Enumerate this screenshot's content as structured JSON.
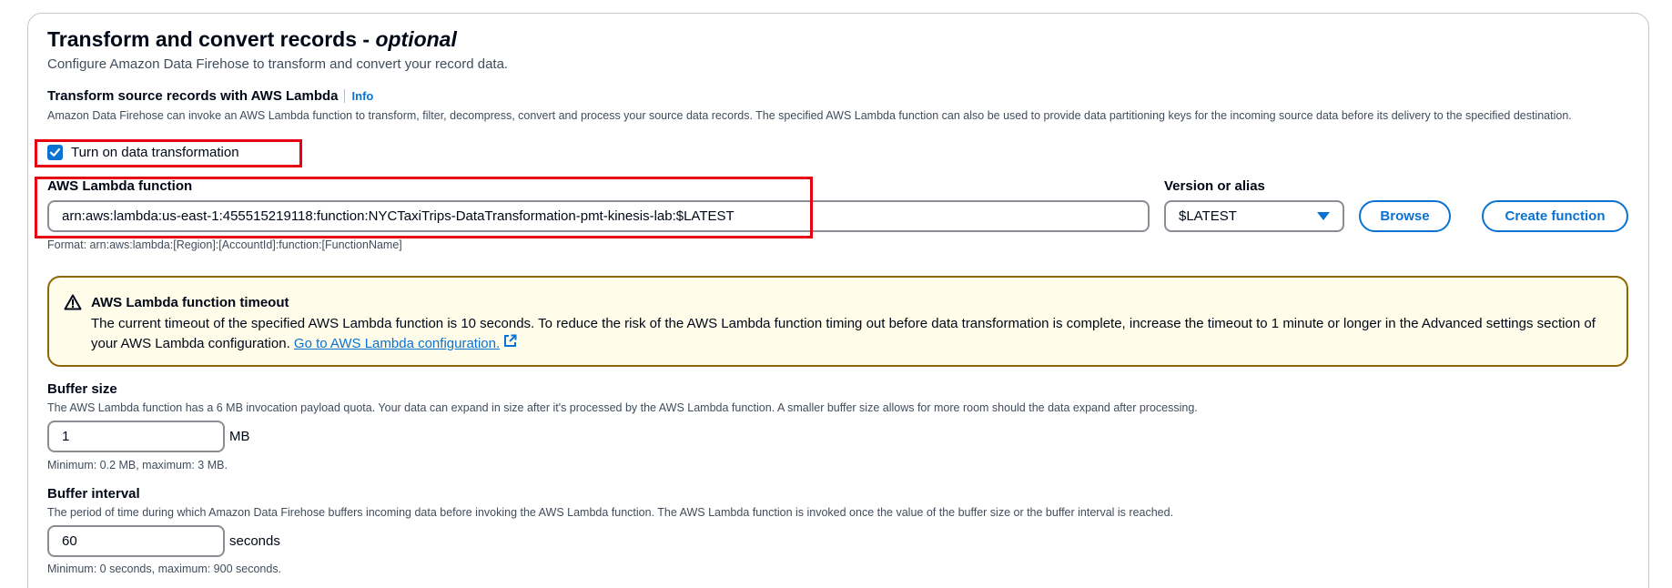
{
  "section": {
    "title": "Transform and convert records - ",
    "title_optional": "optional",
    "description": "Configure Amazon Data Firehose to transform and convert your record data."
  },
  "transform": {
    "label": "Transform source records with AWS Lambda",
    "info": "Info",
    "description": "Amazon Data Firehose can invoke an AWS Lambda function to transform, filter, decompress, convert and process your source data records. The specified AWS Lambda function can also be used to provide data partitioning keys for the incoming source data before its delivery to the specified destination.",
    "checkbox_label": "Turn on data transformation",
    "checkbox_checked": true
  },
  "lambda": {
    "label": "AWS Lambda function",
    "value": "arn:aws:lambda:us-east-1:455515219118:function:NYCTaxiTrips-DataTransformation-pmt-kinesis-lab:$LATEST",
    "format_hint": "Format: arn:aws:lambda:[Region]:[AccountId]:function:[FunctionName]"
  },
  "version": {
    "label": "Version or alias",
    "selected": "$LATEST"
  },
  "buttons": {
    "browse": "Browse",
    "create_function": "Create function"
  },
  "alert": {
    "title": "AWS Lambda function timeout",
    "body": "The current timeout of the specified AWS Lambda function is 10 seconds. To reduce the risk of the AWS Lambda function timing out before data transformation is complete, increase the timeout to 1 minute or longer in the Advanced settings section of your AWS Lambda configuration. ",
    "link": "Go to AWS Lambda configuration.",
    "color_border": "#8d6605",
    "color_bg": "#fffce9"
  },
  "buffer_size": {
    "label": "Buffer size",
    "description": "The AWS Lambda function has a 6 MB invocation payload quota. Your data can expand in size after it's processed by the AWS Lambda function. A smaller buffer size allows for more room should the data expand after processing.",
    "value": "1",
    "unit": "MB",
    "hint": "Minimum: 0.2 MB, maximum: 3 MB."
  },
  "buffer_interval": {
    "label": "Buffer interval",
    "description": "The period of time during which Amazon Data Firehose buffers incoming data before invoking the AWS Lambda function. The AWS Lambda function is invoked once the value of the buffer size or the buffer interval is reached.",
    "value": "60",
    "unit": "seconds",
    "hint": "Minimum: 0 seconds, maximum: 900 seconds."
  },
  "colors": {
    "accent": "#0972d3",
    "highlight": "#e60012",
    "text": "#000716",
    "muted": "#414d5c"
  },
  "icons": {
    "checkbox": "check-icon",
    "alert": "warning-triangle-icon",
    "link": "external-link-icon",
    "select": "caret-down-icon"
  }
}
